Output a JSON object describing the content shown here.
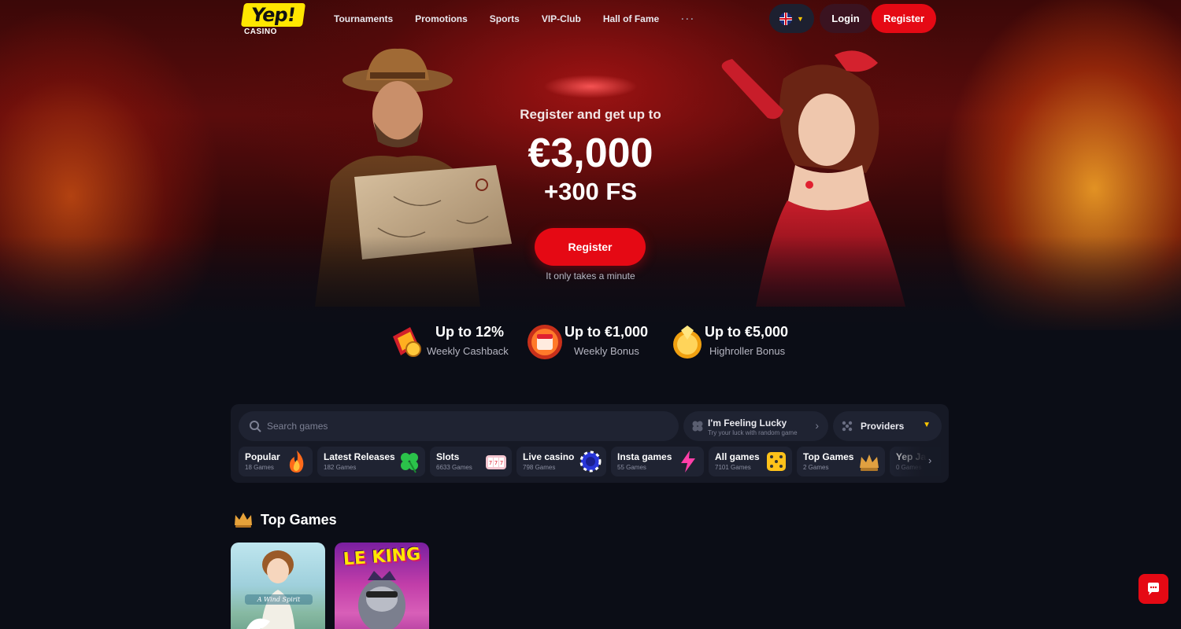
{
  "header": {
    "logo_text": "Yep!",
    "logo_sub": "CASINO",
    "nav": [
      {
        "label": "Tournaments"
      },
      {
        "label": "Promotions"
      },
      {
        "label": "Sports"
      },
      {
        "label": "VIP-Club"
      },
      {
        "label": "Hall of Fame"
      }
    ],
    "more_label": "···",
    "language_icon": "uk-flag-icon",
    "login_label": "Login",
    "register_label": "Register"
  },
  "hero": {
    "subtitle": "Register and get up to",
    "amount": "€3,000",
    "free_spins": "+300 FS",
    "register_label": "Register",
    "note": "It only takes a minute"
  },
  "benefits": [
    {
      "title": "Up to 12%",
      "subtitle": "Weekly Cashback",
      "icon": "cashback-icon"
    },
    {
      "title": "Up to €1,000",
      "subtitle": "Weekly Bonus",
      "icon": "calendar-bonus-icon"
    },
    {
      "title": "Up to €5,000",
      "subtitle": "Highroller Bonus",
      "icon": "gem-coin-icon"
    }
  ],
  "games_panel": {
    "search_placeholder": "Search games",
    "lucky_title": "I'm Feeling Lucky",
    "lucky_subtitle": "Try your luck with random game",
    "providers_label": "Providers",
    "categories": [
      {
        "label": "Popular",
        "count": "18 Games",
        "icon": "fire-icon"
      },
      {
        "label": "Latest Releases",
        "count": "182 Games",
        "icon": "clover-icon"
      },
      {
        "label": "Slots",
        "count": "6633 Games",
        "icon": "slot-reels-icon"
      },
      {
        "label": "Live casino",
        "count": "798 Games",
        "icon": "casino-chip-icon"
      },
      {
        "label": "Insta games",
        "count": "55 Games",
        "icon": "lightning-icon"
      },
      {
        "label": "All games",
        "count": "7101 Games",
        "icon": "dice-icon"
      },
      {
        "label": "Top Games",
        "count": "2 Games",
        "icon": "crown-icon"
      },
      {
        "label": "Yep Ja",
        "count": "0 Games",
        "icon": "jackpot-icon"
      }
    ]
  },
  "top_games": {
    "title": "Top Games",
    "games": [
      {
        "name": "A Wind Spirit",
        "caption": "A Wind Spirit"
      },
      {
        "name": "Le King",
        "logo": "LE KING"
      }
    ]
  },
  "colors": {
    "accent_red": "#e50914",
    "accent_yellow": "#ffe600",
    "panel_bg": "#161925",
    "page_bg": "#0b0d16"
  }
}
